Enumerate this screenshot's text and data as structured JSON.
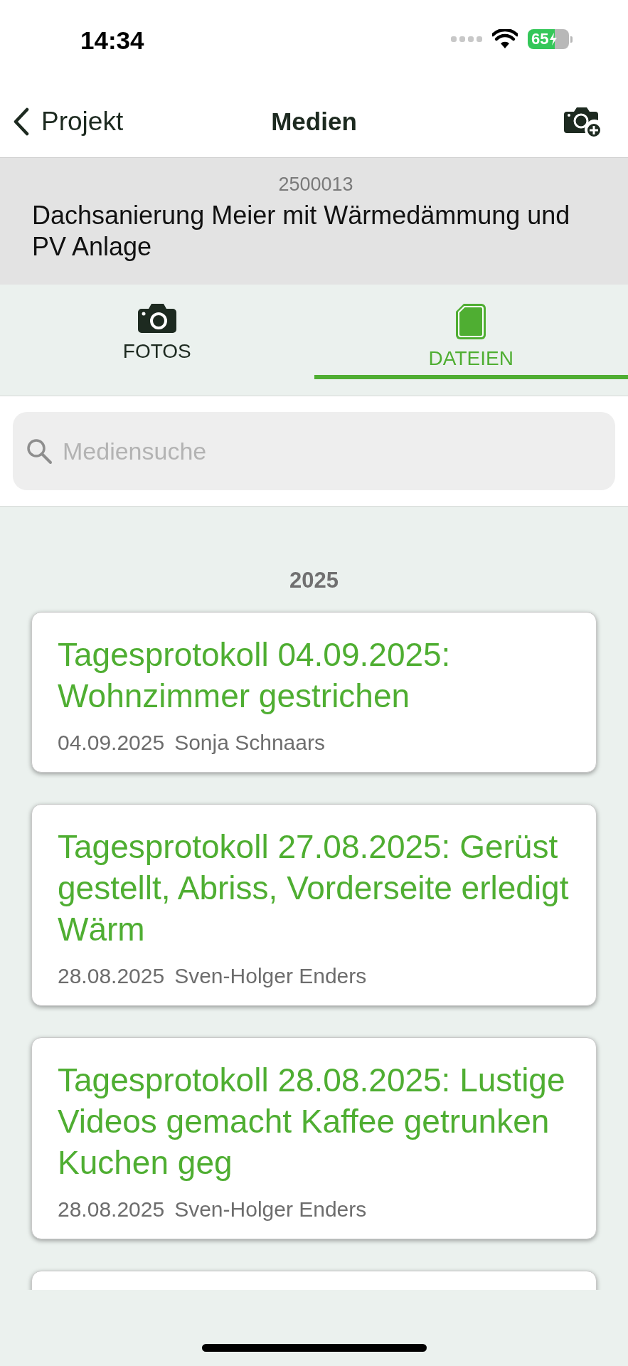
{
  "status_bar": {
    "time": "14:34",
    "battery": "65"
  },
  "nav": {
    "back": "Projekt",
    "title": "Medien"
  },
  "project": {
    "number": "2500013",
    "name": "Dachsanierung Meier mit Wärmedämmung und PV Anlage"
  },
  "tabs": [
    {
      "label": "FOTOS",
      "kind": "photos",
      "selected": false
    },
    {
      "label": "DATEIEN",
      "kind": "files",
      "selected": true
    }
  ],
  "search": {
    "placeholder": "Mediensuche"
  },
  "sections": [
    {
      "year": "2025",
      "items": [
        {
          "kind": "file",
          "title": "Tagesprotokoll 04.09.2025: Wohnzimmer gestrichen",
          "date": "04.09.2025",
          "author": "Sonja Schnaars"
        },
        {
          "kind": "file",
          "title": "Tagesprotokoll 27.08.2025: Gerüst gestellt, Abriss, Vorderseite erledigt Wärm",
          "date": "28.08.2025",
          "author": "Sven-Holger Enders"
        },
        {
          "kind": "file",
          "title": "Tagesprotokoll 28.08.2025: Lustige Videos gemacht Kaffee getrunken Kuchen geg",
          "date": "28.08.2025",
          "author": "Sven-Holger Enders"
        },
        {
          "kind": "clipped"
        }
      ]
    }
  ]
}
